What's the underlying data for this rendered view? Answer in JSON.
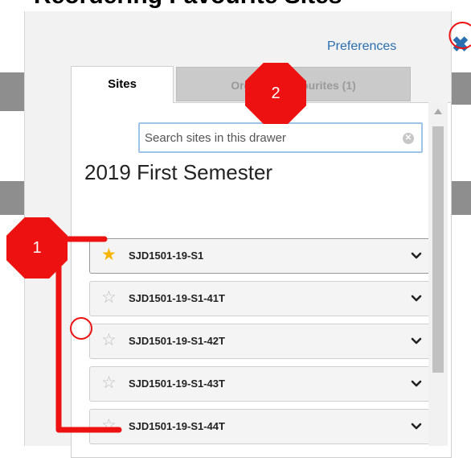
{
  "page_title": "Reordering Favourite Sites",
  "drawer": {
    "preferences_label": "Preferences",
    "close_glyph": "✖",
    "tabs": [
      {
        "label": "Sites"
      },
      {
        "label": "Organize Favourites (1)"
      }
    ],
    "search": {
      "value": "",
      "placeholder": "Search sites in this drawer"
    },
    "clear_glyph": "✕",
    "term_heading": "2019 First Semester",
    "sites": [
      {
        "name": "SJD1501-19-S1",
        "favourite": true
      },
      {
        "name": "SJD1501-19-S1-41T",
        "favourite": false
      },
      {
        "name": "SJD1501-19-S1-42T",
        "favourite": false
      },
      {
        "name": "SJD1501-19-S1-43T",
        "favourite": false
      },
      {
        "name": "SJD1501-19-S1-44T",
        "favourite": false
      }
    ],
    "icons": {
      "star_filled": "★",
      "star_empty": "☆",
      "chevron": "chevron-down-icon"
    }
  },
  "annotations": {
    "markers": [
      {
        "label": "1"
      },
      {
        "label": "2"
      }
    ],
    "color": "#ee1111"
  },
  "colors": {
    "link": "#2a6fb0",
    "star_filled": "#f7b500",
    "star_empty": "#bdbdbd",
    "annotation": "#ee1111"
  }
}
